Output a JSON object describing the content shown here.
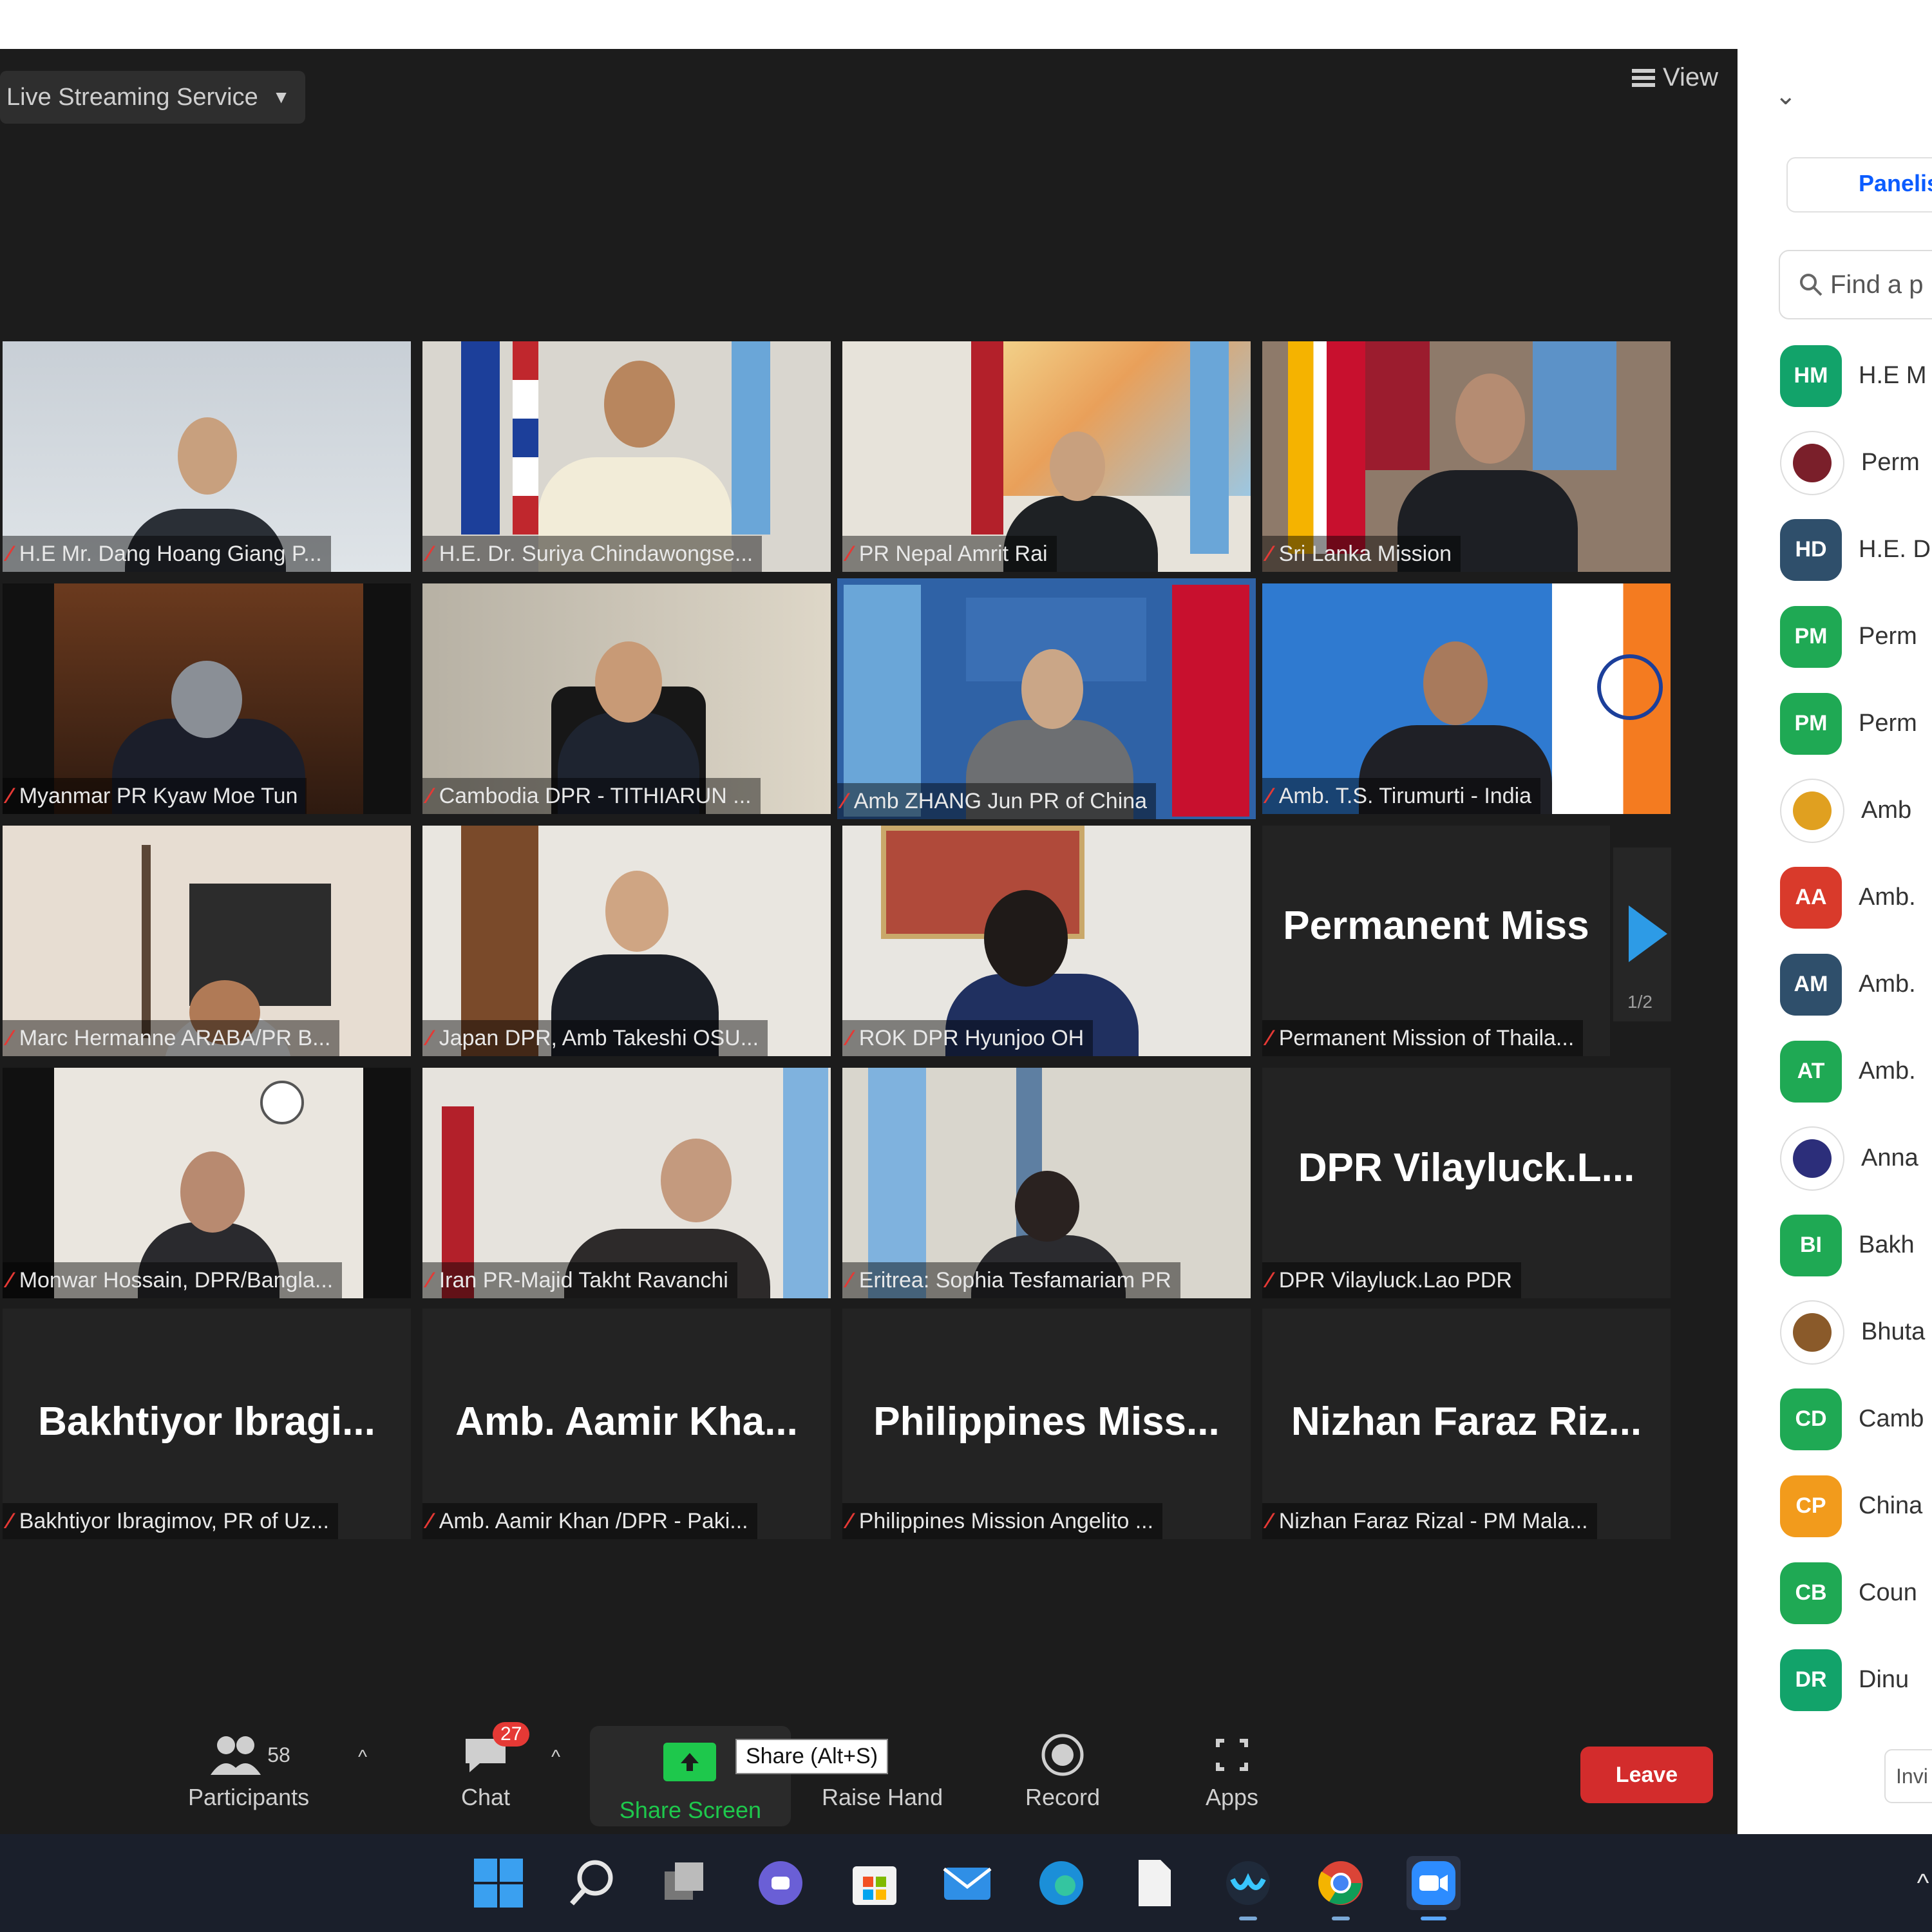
{
  "meeting": {
    "live_streaming_label": "Live Streaming Service",
    "view_label": "View",
    "page_indicator": "1/2"
  },
  "video_tiles": [
    {
      "caption": "H.E Mr. Dang Hoang Giang P...",
      "big": ""
    },
    {
      "caption": "H.E. Dr. Suriya Chindawongse...",
      "big": ""
    },
    {
      "caption": "PR Nepal Amrit Rai",
      "big": ""
    },
    {
      "caption": "Sri Lanka Mission",
      "big": ""
    },
    {
      "caption": "Myanmar PR Kyaw Moe Tun",
      "big": ""
    },
    {
      "caption": "Cambodia DPR - TITHIARUN ...",
      "big": ""
    },
    {
      "caption": "Amb ZHANG Jun PR of China",
      "big": ""
    },
    {
      "caption": "Amb. T.S. Tirumurti - India",
      "big": ""
    },
    {
      "caption": "Marc Hermanne ARABA/PR B...",
      "big": ""
    },
    {
      "caption": "Japan DPR, Amb Takeshi OSU...",
      "big": ""
    },
    {
      "caption": "ROK DPR Hyunjoo OH",
      "big": ""
    },
    {
      "caption": "Permanent Mission of Thaila...",
      "big": "Permanent Miss"
    },
    {
      "caption": "Monwar Hossain, DPR/Bangla...",
      "big": ""
    },
    {
      "caption": "Iran PR-Majid Takht Ravanchi",
      "big": ""
    },
    {
      "caption": "Eritrea: Sophia Tesfamariam PR",
      "big": ""
    },
    {
      "caption": "DPR Vilayluck.Lao PDR",
      "big": "DPR Vilayluck.L..."
    },
    {
      "caption": "Bakhtiyor Ibragimov, PR of Uz...",
      "big": "Bakhtiyor Ibragi..."
    },
    {
      "caption": "Amb. Aamir Khan /DPR - Paki...",
      "big": "Amb. Aamir Kha..."
    },
    {
      "caption": "Philippines Mission Angelito ...",
      "big": "Philippines Miss..."
    },
    {
      "caption": "Nizhan Faraz Rizal - PM Mala...",
      "big": "Nizhan Faraz Riz..."
    }
  ],
  "toolbar": {
    "participants_label": "Participants",
    "participants_count": "58",
    "chat_label": "Chat",
    "chat_badge": "27",
    "share_label": "Share Screen",
    "share_tooltip": "Share (Alt+S)",
    "raise_hand_label": "Raise Hand",
    "record_label": "Record",
    "apps_label": "Apps",
    "leave_label": "Leave"
  },
  "panel": {
    "tab_label": "Panelis",
    "search_placeholder": "Find a p",
    "invite_label": "Invi",
    "participants": [
      {
        "initials": "HM",
        "name": "H.E M",
        "color": "#12a36a"
      },
      {
        "initials": "",
        "name": "Perm",
        "color": "#7a1f2a"
      },
      {
        "initials": "HD",
        "name": "H.E. D",
        "color": "#2f4f6b"
      },
      {
        "initials": "PM",
        "name": "Perm",
        "color": "#1fa954"
      },
      {
        "initials": "PM",
        "name": "Perm",
        "color": "#1fa954"
      },
      {
        "initials": "",
        "name": "Amb",
        "color": "#e0a020"
      },
      {
        "initials": "AA",
        "name": "Amb.",
        "color": "#d93a2b"
      },
      {
        "initials": "AM",
        "name": "Amb.",
        "color": "#2f4f6b"
      },
      {
        "initials": "AT",
        "name": "Amb.",
        "color": "#1fa954"
      },
      {
        "initials": "",
        "name": "Anna",
        "color": "#2c2e7a"
      },
      {
        "initials": "BI",
        "name": "Bakh",
        "color": "#1fa954"
      },
      {
        "initials": "",
        "name": "Bhuta",
        "color": "#8a5a2a"
      },
      {
        "initials": "CD",
        "name": "Camb",
        "color": "#1fa954"
      },
      {
        "initials": "CP",
        "name": "China",
        "color": "#f29b1c"
      },
      {
        "initials": "CB",
        "name": "Coun",
        "color": "#1fa954"
      },
      {
        "initials": "DR",
        "name": "Dinu",
        "color": "#12a36a"
      }
    ]
  },
  "colors": {
    "leave": "#d32c2c",
    "share_icon": "#1ec84c",
    "active_speaker_border": "#e8e05a",
    "accent": "#0b5cff"
  }
}
